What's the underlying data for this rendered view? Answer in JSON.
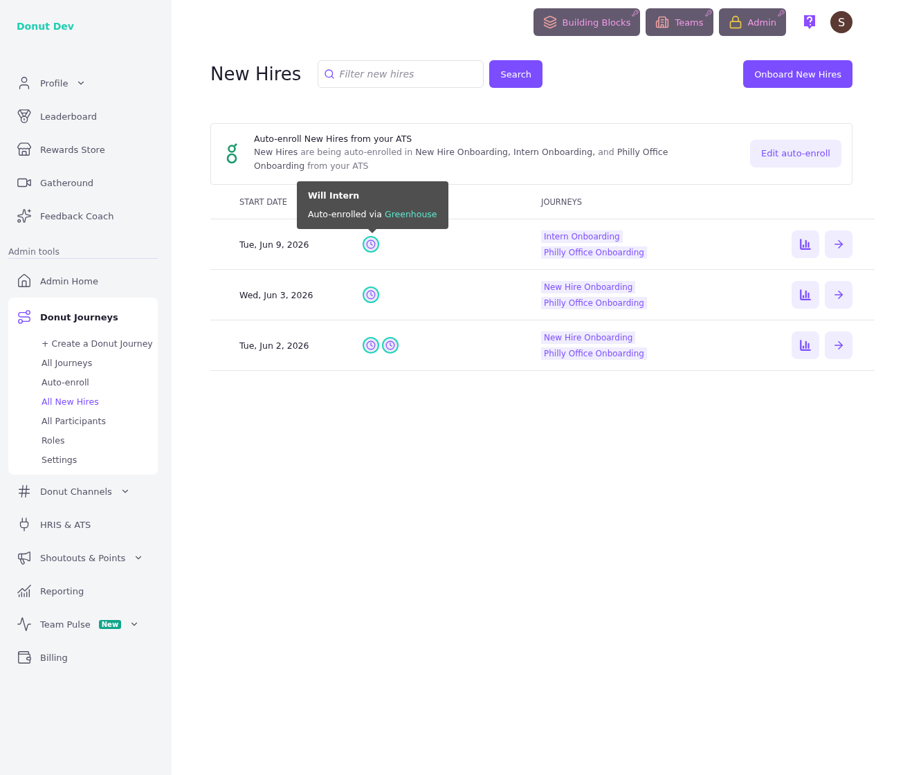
{
  "brand": "Donut Dev",
  "nav": [
    {
      "label": "Profile",
      "dropdown": true
    },
    {
      "label": "Leaderboard",
      "dropdown": false
    },
    {
      "label": "Rewards Store",
      "dropdown": false
    },
    {
      "label": "Gatheround",
      "dropdown": false
    },
    {
      "label": "Feedback Coach",
      "dropdown": false
    }
  ],
  "admin_section": {
    "title": "Admin tools",
    "items": [
      {
        "label": "Admin Home",
        "dropdown": false,
        "expanded": false
      },
      {
        "label": "Donut Journeys",
        "dropdown": false,
        "expanded": true,
        "children": [
          {
            "label": "+ Create a Donut Journey",
            "selected": false
          },
          {
            "label": "All Journeys",
            "selected": false
          },
          {
            "label": "Auto-enroll",
            "selected": false
          },
          {
            "label": "All New Hires",
            "selected": true
          },
          {
            "label": "All Participants",
            "selected": false
          },
          {
            "label": "Roles",
            "selected": false
          },
          {
            "label": "Settings",
            "selected": false
          }
        ]
      },
      {
        "label": "Donut Channels",
        "dropdown": true,
        "expanded": false
      },
      {
        "label": "HRIS & ATS",
        "dropdown": false,
        "expanded": false
      },
      {
        "label": "Shoutouts & Points",
        "dropdown": true,
        "expanded": false
      },
      {
        "label": "Reporting",
        "dropdown": false,
        "expanded": false
      },
      {
        "label": "Team Pulse",
        "dropdown": true,
        "expanded": false,
        "badge": "New"
      },
      {
        "label": "Billing",
        "dropdown": false,
        "expanded": false
      }
    ]
  },
  "top_buttons": [
    "Building Blocks",
    "Teams",
    "Admin"
  ],
  "avatar": "S",
  "title": "New Hires",
  "search": {
    "placeholder": "Filter new hires",
    "button": "Search"
  },
  "primary_button": "Onboard New Hires",
  "banner": {
    "title": "Auto-enroll New Hires from your ATS",
    "text": "**New Hires** are being auto-enrolled in **New Hire Onboarding, Intern Onboarding,** and **Philly Office Onboarding** from your ATS",
    "button": "Edit auto-enroll"
  },
  "table": {
    "columns": [
      "START DATE",
      "",
      "JOURNEYS"
    ],
    "rows": [
      {
        "start_date": "Tue, Jun 9, 2026",
        "hires": [
          {
            "auto_enrolled": true
          }
        ],
        "journeys": [
          "Intern Onboarding",
          "Philly Office Onboarding"
        ]
      },
      {
        "start_date": "Wed, Jun 3, 2026",
        "hires": [
          {
            "auto_enrolled": true
          }
        ],
        "journeys": [
          "New Hire Onboarding",
          "Philly Office Onboarding"
        ]
      },
      {
        "start_date": "Tue, Jun 2, 2026",
        "hires": [
          {
            "auto_enrolled": true
          },
          {
            "auto_enrolled": true
          }
        ],
        "journeys": [
          "New Hire Onboarding",
          "Philly Office Onboarding"
        ]
      }
    ]
  },
  "tooltip": {
    "name": "Will Intern",
    "text": "Auto-enrolled via",
    "link": "Greenhouse"
  }
}
